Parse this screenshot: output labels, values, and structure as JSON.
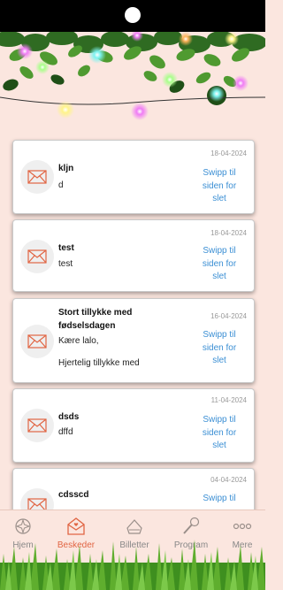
{
  "messages": [
    {
      "title": "kljn",
      "body": "d",
      "date": "18-04-2024",
      "swipe": "Swipp til siden for slet"
    },
    {
      "title": "test",
      "body": "test",
      "date": "18-04-2024",
      "swipe": "Swipp til siden for slet"
    },
    {
      "title": "Stort tillykke med fødselsdagen",
      "body_line1": "Kære lalo,",
      "body_line2": "Hjertelig tillykke med",
      "date": "16-04-2024",
      "swipe": "Swipp til siden for slet"
    },
    {
      "title": "dsds",
      "body": "dffd",
      "date": "11-04-2024",
      "swipe": "Swipp til siden for slet"
    },
    {
      "title": "cdsscd",
      "date": "04-04-2024",
      "swipe": "Swipp til"
    }
  ],
  "nav": {
    "items": [
      {
        "label": "Hjem",
        "icon": "home-icon"
      },
      {
        "label": "Beskeder",
        "icon": "mail-icon",
        "active": true
      },
      {
        "label": "Billetter",
        "icon": "ticket-icon"
      },
      {
        "label": "Program",
        "icon": "microphone-icon"
      },
      {
        "label": "Mere",
        "icon": "more-icon"
      }
    ]
  },
  "colors": {
    "accent": "#e16543",
    "link": "#3b8fd4",
    "background": "#fbe6df"
  }
}
